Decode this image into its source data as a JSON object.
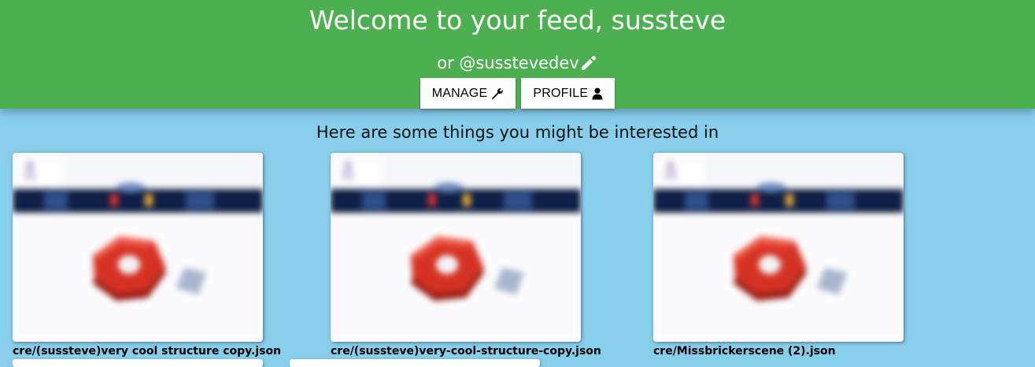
{
  "header": {
    "welcome": "Welcome to your feed, sussteve",
    "handle": "or @susstevedev",
    "edit_icon": "pencil-icon",
    "background": "#4caf50"
  },
  "buttons": {
    "manage_label": "MANAGE",
    "manage_icon": "wrench-icon",
    "profile_label": "PROFILE",
    "profile_icon": "user-icon"
  },
  "feed": {
    "subtitle": "Here are some things you might be interested in",
    "background": "#87ceeb",
    "items": [
      {
        "caption": "cre/(sussteve)very cool structure copy.json"
      },
      {
        "caption": "cre/(sussteve)very-cool-structure-copy.json"
      },
      {
        "caption": "cre/Missbrickerscene (2).json"
      }
    ]
  }
}
